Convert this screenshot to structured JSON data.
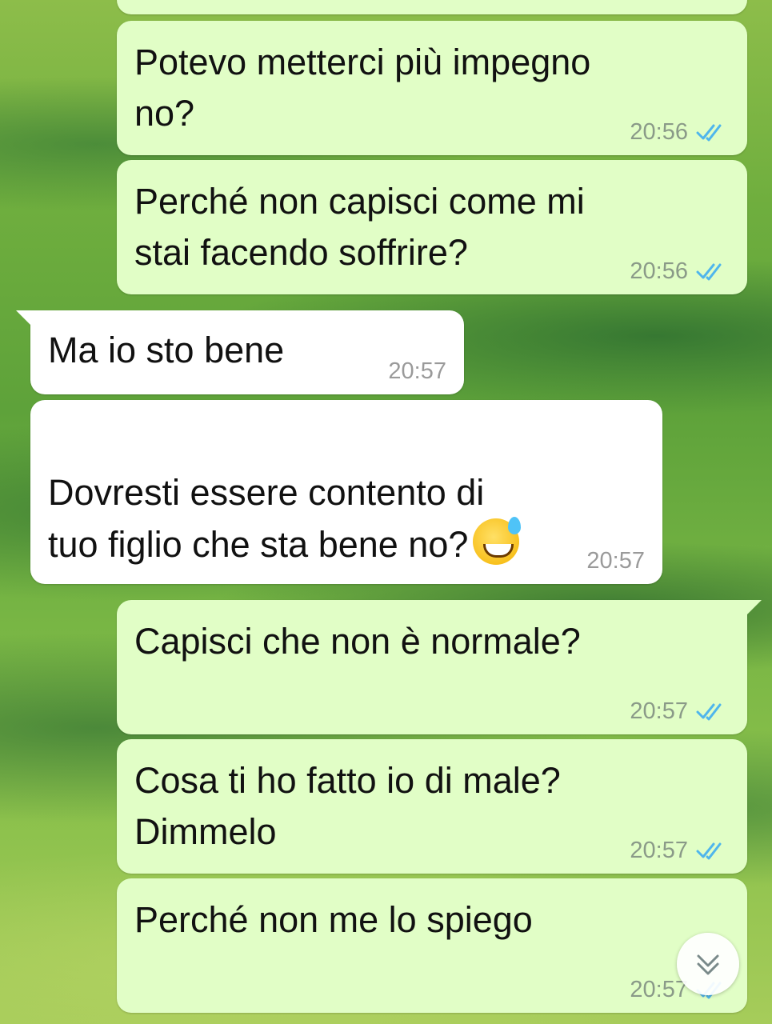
{
  "messages": [
    {
      "direction": "out",
      "text": "Potevo metterci più impegno\nno?",
      "time": "20:56",
      "status": "read"
    },
    {
      "direction": "out",
      "text": "Perché non capisci come mi\nstai facendo soffrire?",
      "time": "20:56",
      "status": "read"
    },
    {
      "direction": "in",
      "text": "Ma io sto bene",
      "time": "20:57"
    },
    {
      "direction": "in",
      "text": "Dovresti essere contento di\ntuo figlio che sta bene no?",
      "time": "20:57",
      "emoji": "grinning-face-with-sweat"
    },
    {
      "direction": "out",
      "text": "Capisci che non è normale?",
      "time": "20:57",
      "status": "read"
    },
    {
      "direction": "out",
      "text": "Cosa ti ho fatto io di male?\nDimmelo",
      "time": "20:57",
      "status": "read"
    },
    {
      "direction": "out",
      "text": "Perché non me lo spiego",
      "time": "20:57",
      "status": "read"
    }
  ],
  "colors": {
    "outgoing_bubble": "#e1fec6",
    "incoming_bubble": "#ffffff",
    "read_ticks": "#4fb6ec"
  },
  "icons": {
    "read_status": "double-check-icon",
    "scroll_down": "chevron-down-icon"
  }
}
